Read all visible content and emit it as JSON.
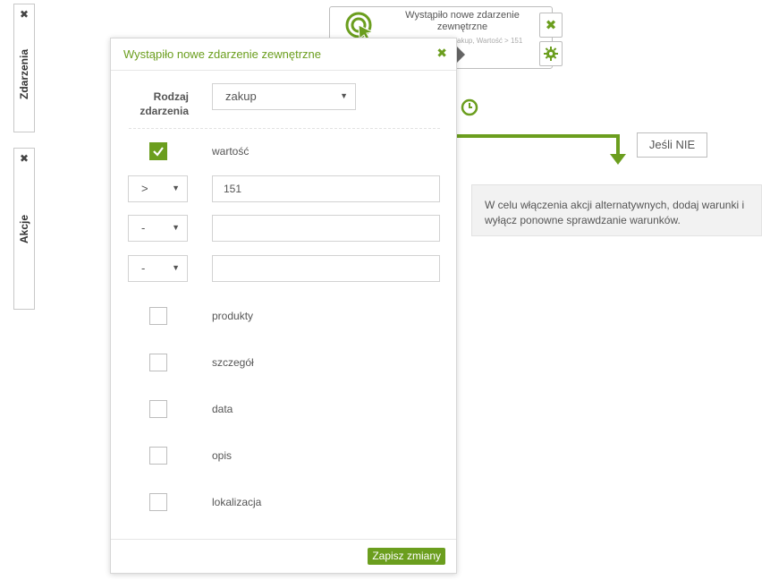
{
  "sidebar": {
    "events_tab": {
      "label": "Zdarzenia"
    },
    "actions_tab": {
      "label": "Akcje"
    }
  },
  "canvas": {
    "node": {
      "title": "Wystąpiło nowe zdarzenie zewnętrzne",
      "subtitle": "zakup, Wartość > 151"
    },
    "if_no_label": "Jeśli NIE",
    "info_text": "W celu włączenia akcji alternatywnych, dodaj warunki i wyłącz ponowne sprawdzanie warunków."
  },
  "modal": {
    "title": "Wystąpiło nowe zdarzenie zewnętrzne",
    "event_type_label": "Rodzaj zdarzenia",
    "event_type_value": "zakup",
    "conditions": {
      "field_label": "wartość",
      "field_checked": true,
      "rows": [
        {
          "operator": ">",
          "value": "151"
        },
        {
          "operator": "-",
          "value": ""
        },
        {
          "operator": "-",
          "value": ""
        }
      ]
    },
    "fields": [
      {
        "label": "produkty",
        "checked": false
      },
      {
        "label": "szczegół",
        "checked": false
      },
      {
        "label": "data",
        "checked": false
      },
      {
        "label": "opis",
        "checked": false
      },
      {
        "label": "lokalizacja",
        "checked": false
      }
    ],
    "save_label": "Zapisz zmiany"
  },
  "colors": {
    "accent": "#6b9e1e"
  }
}
